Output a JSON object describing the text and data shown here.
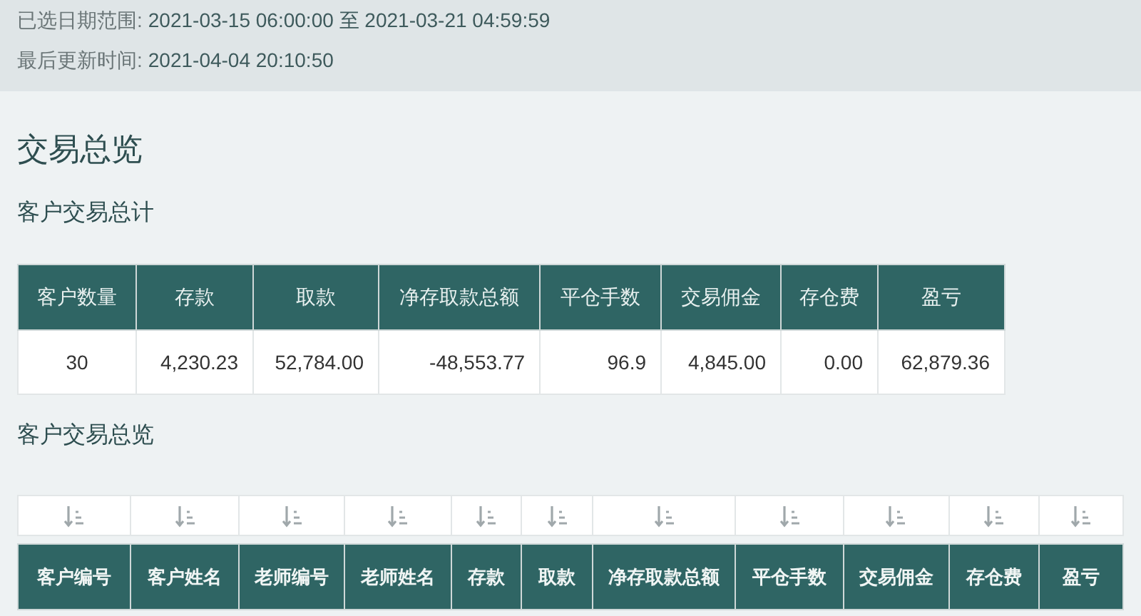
{
  "info": [
    {
      "label": "已选日期范围:",
      "value": "2021-03-15 06:00:00 至 2021-03-21 04:59:59"
    },
    {
      "label": "最后更新时间:",
      "value": "2021-04-04 20:10:50"
    }
  ],
  "title": "交易总览",
  "summary": {
    "title": "客户交易总计",
    "columns": [
      "客户数量",
      "存款",
      "取款",
      "净存取款总额",
      "平仓手数",
      "交易佣金",
      "存仓费",
      "盈亏"
    ],
    "rows": [
      [
        "30",
        "4,230.23",
        "52,784.00",
        "-48,553.77",
        "96.9",
        "4,845.00",
        "0.00",
        "62,879.36"
      ]
    ]
  },
  "overview": {
    "title": "客户交易总览",
    "columns": [
      "客户编号",
      "客户姓名",
      "老师编号",
      "老师姓名",
      "存款",
      "取款",
      "净存取款总额",
      "平仓手数",
      "交易佣金",
      "存仓费",
      "盈亏"
    ]
  }
}
